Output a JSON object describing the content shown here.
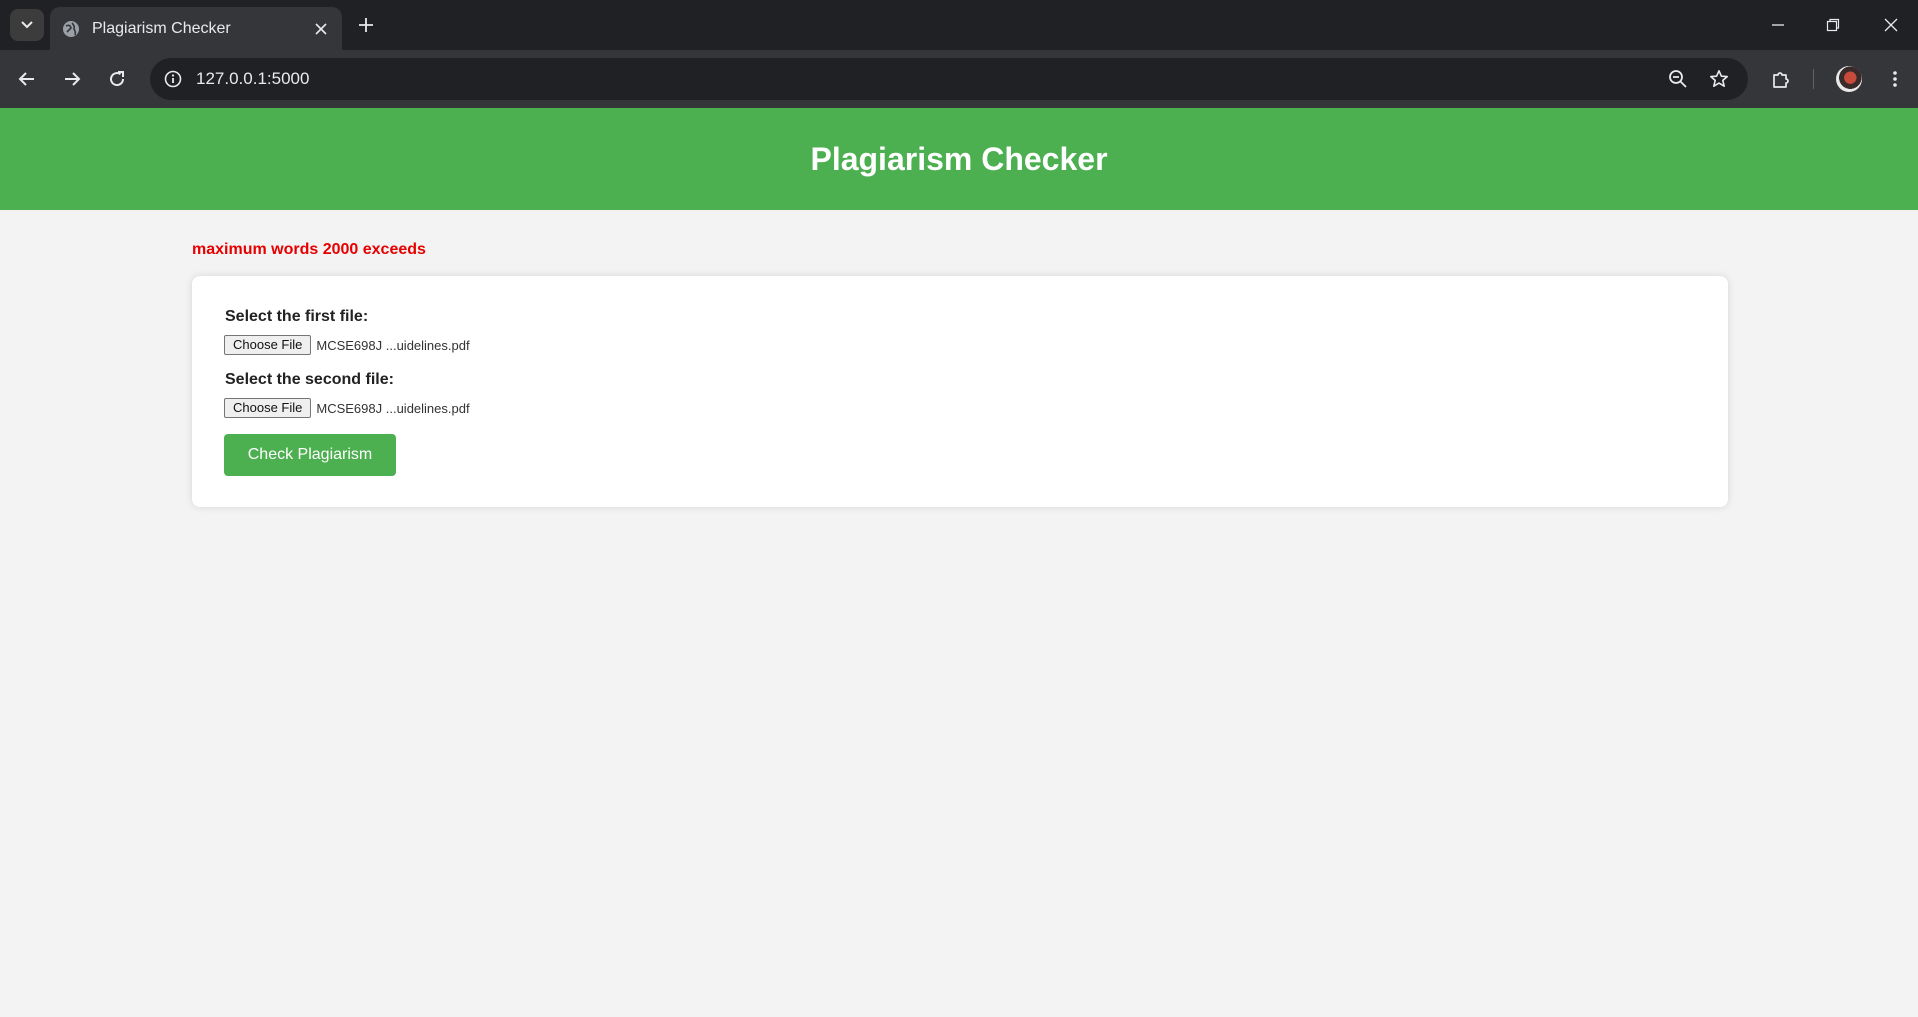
{
  "browser": {
    "tab_title": "Plagiarism Checker",
    "url": "127.0.0.1:5000"
  },
  "page": {
    "header_title": "Plagiarism Checker",
    "error_message": "maximum words 2000 exceeds",
    "first_file": {
      "label": "Select the first file:",
      "button_label": "Choose File",
      "selected_name": "MCSE698J ...uidelines.pdf"
    },
    "second_file": {
      "label": "Select the second file:",
      "button_label": "Choose File",
      "selected_name": "MCSE698J ...uidelines.pdf"
    },
    "submit_label": "Check Plagiarism"
  },
  "colors": {
    "header_green": "#4caf50",
    "error_red": "#e60000",
    "button_green": "#4caf50"
  },
  "icons": [
    "tab-search-icon",
    "globe-icon",
    "close-icon",
    "plus-icon",
    "minimize-icon",
    "restore-icon",
    "window-close-icon",
    "back-arrow-icon",
    "forward-arrow-icon",
    "reload-icon",
    "info-icon",
    "zoom-out-icon",
    "star-icon",
    "extensions-icon",
    "avatar",
    "more-menu-icon"
  ]
}
